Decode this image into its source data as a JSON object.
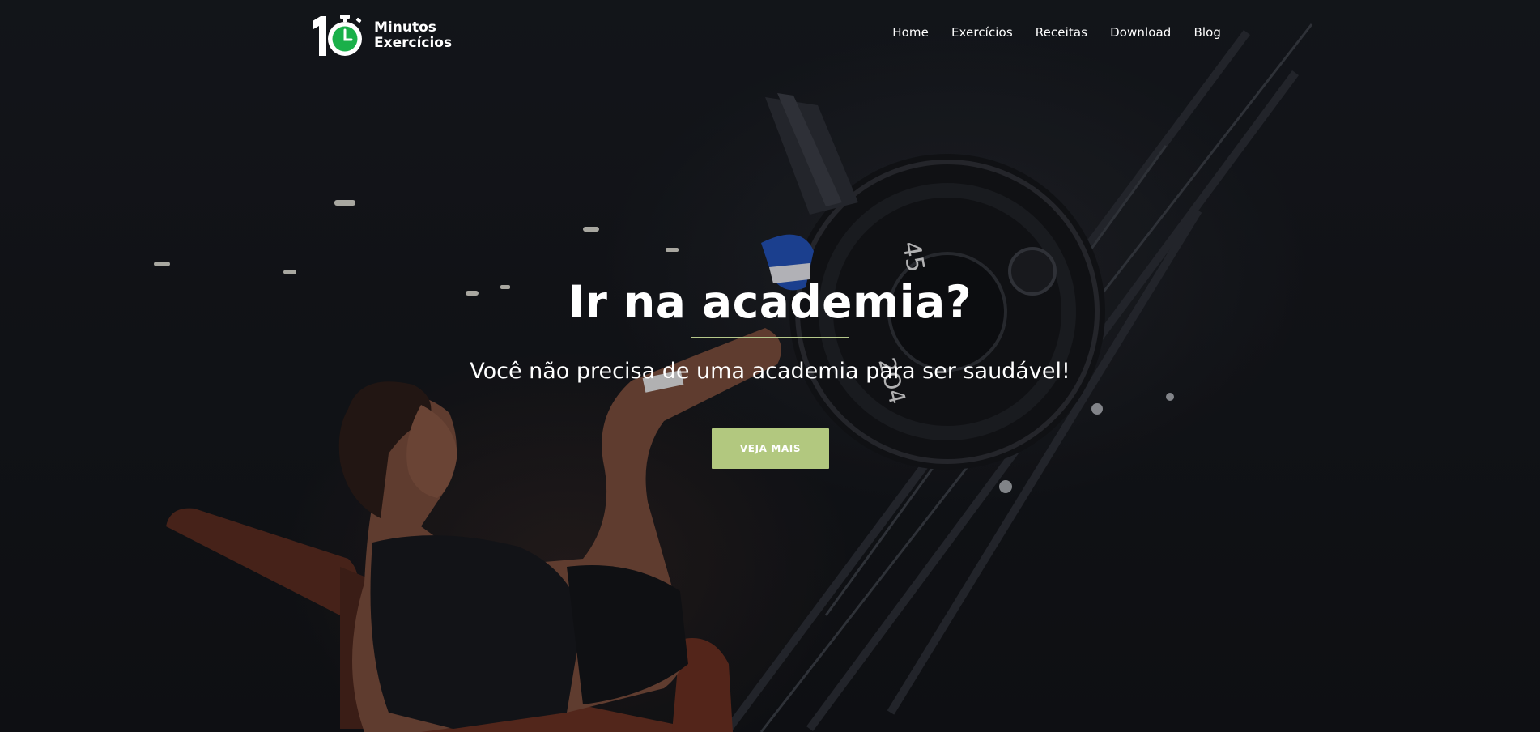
{
  "brand": {
    "logo_digits": "10",
    "line1": "Minutos",
    "line2": "Exercícios",
    "accent_color": "#1ab04a"
  },
  "nav": {
    "items": [
      {
        "label": "Home"
      },
      {
        "label": "Exercícios"
      },
      {
        "label": "Receitas"
      },
      {
        "label": "Download"
      },
      {
        "label": "Blog"
      }
    ]
  },
  "hero": {
    "title": "Ir na academia?",
    "subtitle": "Você não precisa de uma academia para ser saudável!",
    "cta_label": "VEJA MAIS",
    "cta_color": "#b2c87f",
    "divider_color": "#b5c88a",
    "background_image": "gym-woman-leg-press-photo",
    "plate_labels": [
      "45",
      "2O4"
    ]
  }
}
